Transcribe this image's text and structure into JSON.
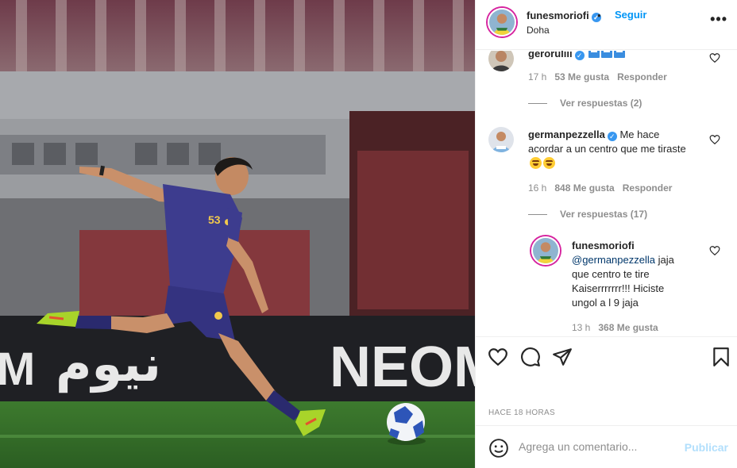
{
  "header": {
    "username": "funesmoriofi",
    "separator": "•",
    "follow_label": "Seguir",
    "location": "Doha",
    "more_label": "•••"
  },
  "photo": {
    "banner_text": "NEOM",
    "arabic_text": "نيوم",
    "left_letter": "M",
    "shirt_number": "53"
  },
  "comments": [
    {
      "username": "geroruliii",
      "text": "",
      "time": "17 h",
      "likes": "53 Me gusta",
      "reply_label": "Responder",
      "view_replies": "Ver respuestas (2)"
    },
    {
      "username": "germanpezzella",
      "text": "Me hace acordar a un centro que me tiraste",
      "time": "16 h",
      "likes": "848 Me gusta",
      "reply_label": "Responder",
      "view_replies": "Ver respuestas (17)"
    },
    {
      "username": "funesmoriofi",
      "mention": "@germanpezzella",
      "text": "jaja que centro te tire Kaiserrrrrrr!!! Hiciste ungol a l 9 jaja",
      "time": "13 h",
      "likes": "368 Me gusta"
    }
  ],
  "post": {
    "time_ago": "HACE 18 HORAS"
  },
  "add_comment": {
    "placeholder": "Agrega un comentario...",
    "publish_label": "Publicar"
  },
  "colors": {
    "accent": "#0095f6",
    "verified": "#3897f0",
    "muted": "#8e8e8e",
    "publish_disabled": "#b2dffc",
    "story_ring": "#d6249f"
  },
  "icons": {
    "like": "heart-icon",
    "comment": "comment-icon",
    "share": "paper-plane-icon",
    "save": "bookmark-icon",
    "emoji": "smiley-icon",
    "more": "ellipsis-icon"
  }
}
